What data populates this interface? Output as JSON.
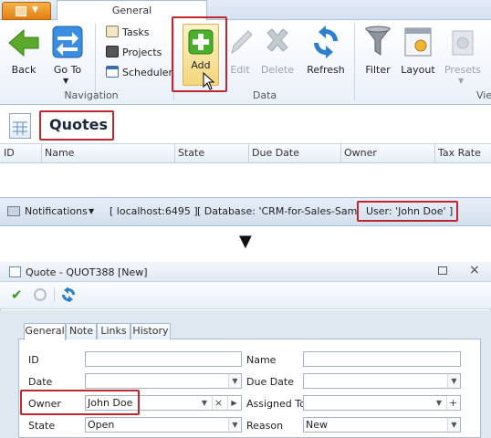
{
  "ribbon": {
    "tab_general": "General",
    "buttons": {
      "back": "Back",
      "go_to": "Go To",
      "tasks": "Tasks",
      "projects": "Projects",
      "scheduler": "Scheduler",
      "add": "Add",
      "edit": "Edit",
      "delete": "Delete",
      "refresh": "Refresh",
      "filter": "Filter",
      "layout": "Layout",
      "presets": "Presets"
    },
    "groups": {
      "navigation": "Navigation",
      "data": "Data",
      "view": "Vie"
    }
  },
  "list_view": {
    "title": "Quotes",
    "columns": [
      "ID",
      "Name",
      "State",
      "Due Date",
      "Owner",
      "Tax Rate"
    ]
  },
  "status_bar": {
    "notifications": "Notifications",
    "server": "[ localhost:6495 ]",
    "database": "[ Database: 'CRM-for-Sales-Sample' ]",
    "user": "User: 'John Doe' ]"
  },
  "dialog": {
    "title": "Quote - QUOT388 [New]",
    "tabs": [
      "General",
      "Note",
      "Links",
      "History"
    ],
    "fields": {
      "id_label": "ID",
      "name_label": "Name",
      "date_label": "Date",
      "due_date_label": "Due Date",
      "owner_label": "Owner",
      "owner_value": "John Doe",
      "assigned_to_label": "Assigned To",
      "state_label": "State",
      "state_value": "Open",
      "reason_label": "Reason",
      "reason_value": "New"
    }
  },
  "colors": {
    "highlight_border": "#c0262d",
    "add_button_bg": "#f6e3a0",
    "app_button": "#e47d12",
    "ribbon_border": "#a9bfd6"
  }
}
